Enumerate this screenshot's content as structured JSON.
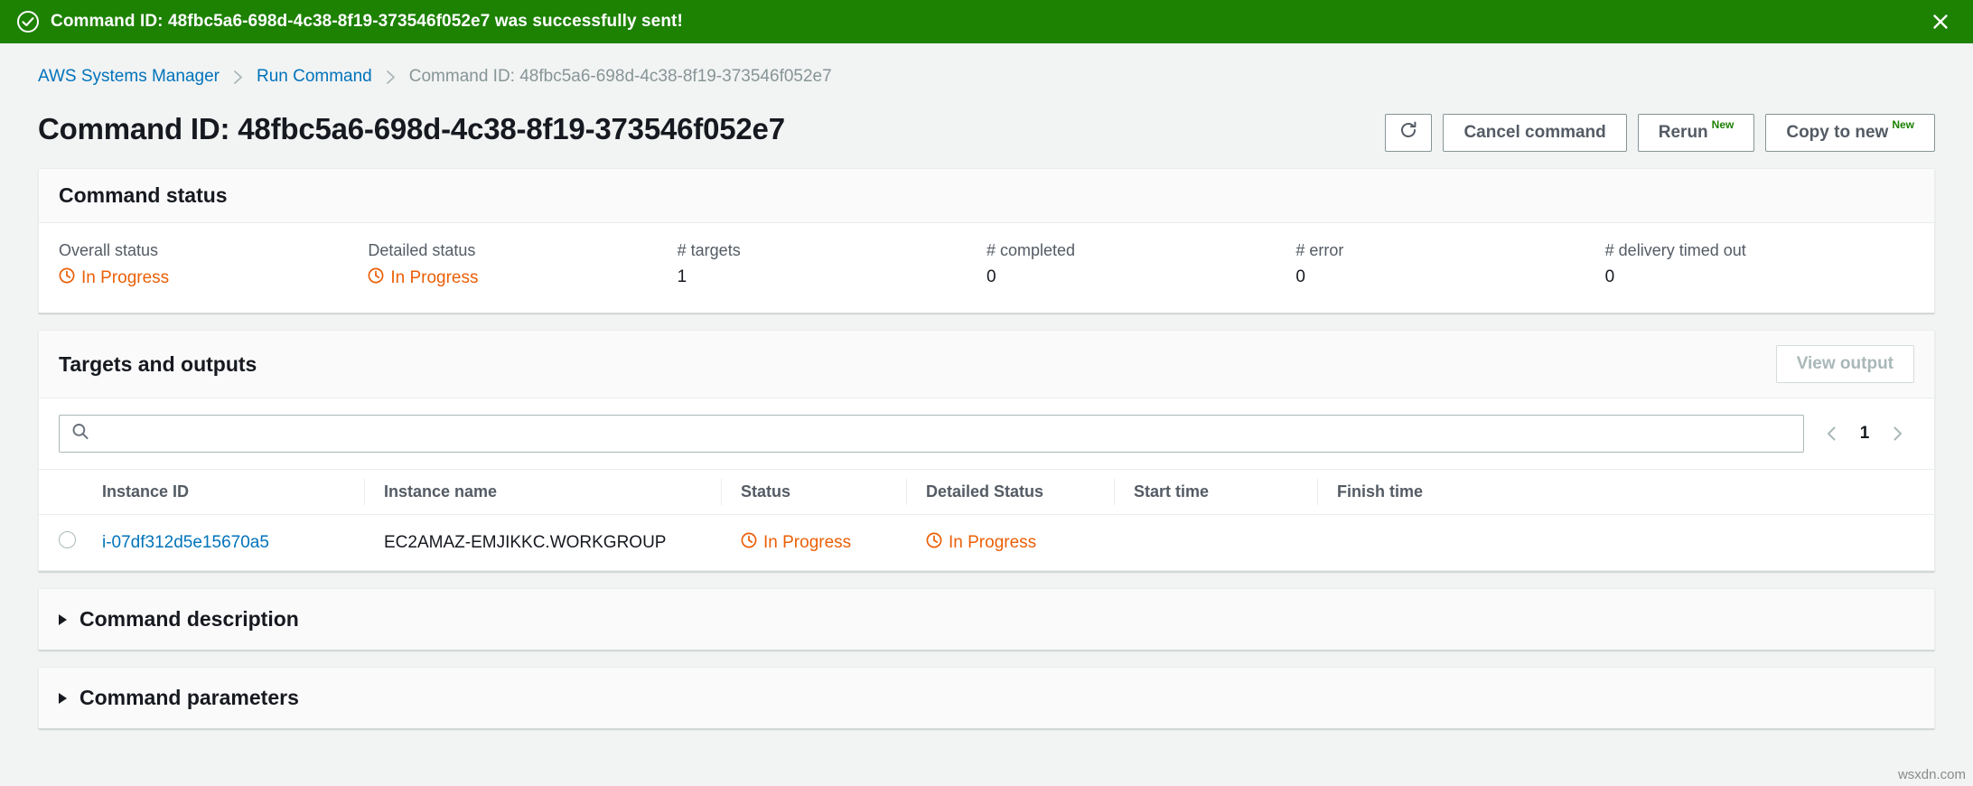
{
  "flash": {
    "icon": "check-circle-icon",
    "message": "Command ID: 48fbc5a6-698d-4c38-8f19-373546f052e7 was successfully sent!",
    "close_icon": "close-icon",
    "background_color": "#1d8102"
  },
  "breadcrumb": {
    "items": [
      {
        "label": "AWS Systems Manager",
        "type": "link"
      },
      {
        "label": "Run Command",
        "type": "link"
      },
      {
        "label": "Command ID: 48fbc5a6-698d-4c38-8f19-373546f052e7",
        "type": "current"
      }
    ]
  },
  "header": {
    "title": "Command ID: 48fbc5a6-698d-4c38-8f19-373546f052e7",
    "actions": {
      "refresh_icon": "refresh-icon",
      "cancel_label": "Cancel command",
      "rerun_label": "Rerun",
      "rerun_badge": "New",
      "copy_to_new_label": "Copy to new",
      "copy_to_new_badge": "New"
    }
  },
  "command_status": {
    "title": "Command status",
    "fields": [
      {
        "label": "Overall status",
        "value": "In Progress",
        "kind": "status"
      },
      {
        "label": "Detailed status",
        "value": "In Progress",
        "kind": "status"
      },
      {
        "label": "# targets",
        "value": "1",
        "kind": "plain"
      },
      {
        "label": "# completed",
        "value": "0",
        "kind": "plain"
      },
      {
        "label": "# error",
        "value": "0",
        "kind": "plain"
      },
      {
        "label": "# delivery timed out",
        "value": "0",
        "kind": "plain"
      }
    ],
    "status_color": "#eb5f07"
  },
  "targets": {
    "title": "Targets and outputs",
    "view_output_label": "View output",
    "view_output_disabled": true,
    "search": {
      "placeholder": "",
      "value": "",
      "icon": "search-icon"
    },
    "pagination": {
      "prev_icon": "chevron-left-icon",
      "page": "1",
      "next_icon": "chevron-right-icon"
    },
    "table": {
      "columns": [
        "Instance ID",
        "Instance name",
        "Status",
        "Detailed Status",
        "Start time",
        "Finish time"
      ],
      "rows": [
        {
          "instance_id": "i-07df312d5e15670a5",
          "instance_name": "EC2AMAZ-EMJIKKC.WORKGROUP",
          "status": "In Progress",
          "detailed_status": "In Progress",
          "start_time": "",
          "finish_time": ""
        }
      ]
    }
  },
  "sections": [
    {
      "title": "Command description",
      "expanded": false
    },
    {
      "title": "Command parameters",
      "expanded": false
    }
  ],
  "watermark": "wsxdn.com"
}
